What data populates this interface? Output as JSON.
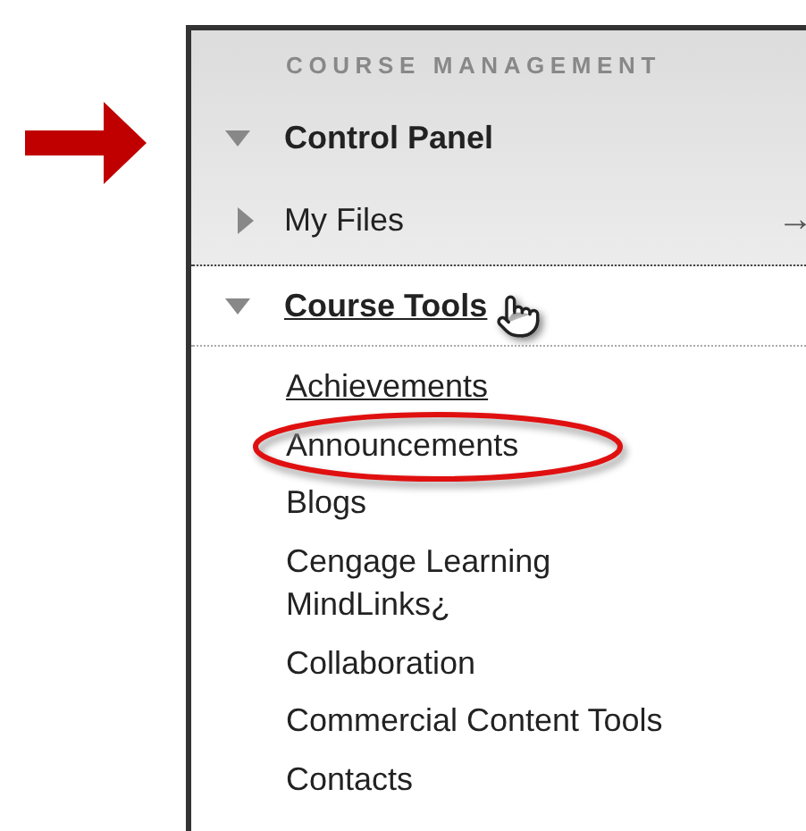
{
  "section_title": "COURSE MANAGEMENT",
  "control_panel": {
    "label": "Control Panel",
    "expanded": true
  },
  "my_files": {
    "label": "My Files",
    "expanded": false,
    "link_arrow": "→"
  },
  "course_tools": {
    "label": "Course Tools",
    "expanded": true,
    "hovered": true
  },
  "tools": [
    {
      "label": "Achievements",
      "hovered": true,
      "circled": false
    },
    {
      "label": "Announcements",
      "hovered": false,
      "circled": true
    },
    {
      "label": "Blogs",
      "hovered": false,
      "circled": false
    },
    {
      "label": "Cengage Learning MindLinks¿",
      "hovered": false,
      "circled": false
    },
    {
      "label": "Collaboration",
      "hovered": false,
      "circled": false
    },
    {
      "label": "Commercial Content Tools",
      "hovered": false,
      "circled": false
    },
    {
      "label": "Contacts",
      "hovered": false,
      "circled": false
    }
  ]
}
